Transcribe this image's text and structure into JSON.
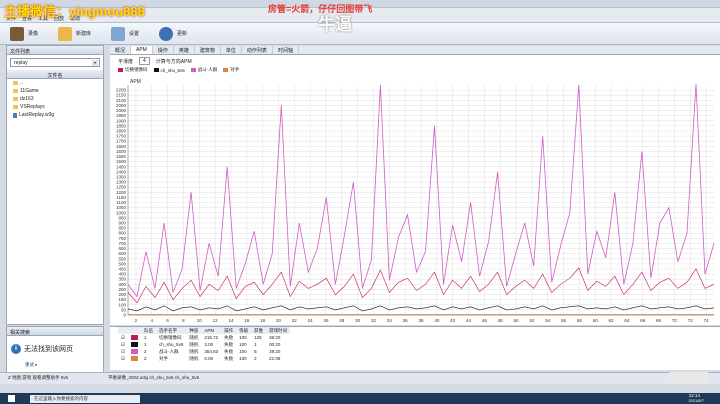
{
  "overlay": {
    "streamer": "主播微信：yingmou888",
    "room_note": "房管=火箭，仔仔回图带飞",
    "big_char": "牛逼"
  },
  "menubar": {
    "items": [
      "文件",
      "查看",
      "工具",
      "回放",
      "帮助"
    ]
  },
  "toolbar": {
    "buttons": [
      {
        "label": "录像",
        "icon": "home-icon"
      },
      {
        "label": "新建库",
        "icon": "box-icon"
      },
      {
        "label": "设置",
        "icon": "settings-icon"
      },
      {
        "label": "更新",
        "icon": "globe-icon"
      }
    ]
  },
  "left": {
    "list_title": "文件列表",
    "combo_value": "replay",
    "tree_title": "文件名",
    "files": [
      "..",
      "11Game",
      "dz163",
      "VSReplays",
      "LastReplay.w3g"
    ],
    "bottom_title": "相关搜索",
    "no_page": "无法找到该网页",
    "bottom_link": "重试 ▸"
  },
  "tabs": [
    "概况",
    "APM",
    "操作",
    "英雄",
    "建筑物",
    "单位",
    "动作列表",
    "时间轴"
  ],
  "chart_opts": {
    "label1": "平滑度",
    "label2": "计算与方向APM",
    "value": "4",
    "apm_label": "APM"
  },
  "legend": [
    "切换镜像码",
    "ch_shu_5v5",
    "战斗·人群",
    "对手"
  ],
  "colors": {
    "series1": "#c2185b",
    "series2": "#111111",
    "series3": "#d25cc7",
    "series4": "#e0843c",
    "grid": "#e0e0e0",
    "accent": "#e53935",
    "overlay_yellow": "#f5e400",
    "overlay_red": "#e53935"
  },
  "chart_data": {
    "type": "line",
    "x_ticks": [
      "2",
      "4",
      "6",
      "8",
      "10",
      "12",
      "14",
      "16",
      "18",
      "20",
      "22",
      "24",
      "26",
      "28",
      "30",
      "32",
      "34",
      "36",
      "38",
      "40",
      "42",
      "44",
      "46",
      "48",
      "50",
      "52",
      "54",
      "56",
      "58",
      "60",
      "62",
      "64",
      "66",
      "68",
      "70",
      "72",
      "74"
    ],
    "y_ticks": [
      2200,
      2150,
      2100,
      2050,
      2000,
      1950,
      1900,
      1850,
      1800,
      1750,
      1700,
      1650,
      1600,
      1550,
      1500,
      1450,
      1400,
      1350,
      1300,
      1250,
      1200,
      1150,
      1100,
      1050,
      1000,
      950,
      900,
      850,
      800,
      750,
      700,
      650,
      600,
      550,
      500,
      450,
      400,
      350,
      300,
      250,
      200,
      150,
      100,
      50,
      0
    ],
    "ylim": [
      0,
      2250
    ],
    "series": [
      {
        "name": "战斗·人群",
        "values": [
          300,
          180,
          620,
          260,
          900,
          220,
          450,
          1200,
          240,
          700,
          380,
          1450,
          260,
          500,
          820,
          300,
          600,
          2050,
          280,
          900,
          420,
          650,
          1150,
          300,
          780,
          1300,
          260,
          540,
          2250,
          340,
          760,
          980,
          420,
          620,
          1850,
          300,
          880,
          520,
          1100,
          380,
          720,
          1400,
          280,
          600,
          900,
          480,
          1750,
          320,
          680,
          1000,
          2250,
          400,
          820,
          560,
          1200,
          300,
          700,
          1600,
          360,
          900,
          1050,
          520,
          800,
          2260,
          400,
          700
        ]
      },
      {
        "name": "切换镜像码",
        "values": [
          220,
          120,
          280,
          170,
          320,
          150,
          260,
          340,
          180,
          300,
          240,
          380,
          160,
          280,
          320,
          200,
          300,
          420,
          180,
          330,
          260,
          300,
          360,
          200,
          280,
          400,
          170,
          260,
          440,
          220,
          320,
          360,
          240,
          300,
          420,
          200,
          340,
          260,
          380,
          230,
          300,
          420,
          200,
          280,
          340,
          260,
          400,
          220,
          300,
          360,
          460,
          240,
          330,
          280,
          380,
          200,
          300,
          420,
          240,
          320,
          360,
          260,
          320,
          450,
          260,
          300
        ]
      },
      {
        "name": "ch_shu_5v5",
        "values": [
          60,
          40,
          80,
          50,
          90,
          40,
          70,
          80,
          50,
          70,
          60,
          90,
          40,
          60,
          80,
          50,
          70,
          90,
          50,
          80,
          60,
          70,
          80,
          50,
          70,
          90,
          40,
          60,
          90,
          50,
          70,
          80,
          60,
          70,
          90,
          50,
          80,
          60,
          80,
          50,
          70,
          90,
          50,
          60,
          80,
          60,
          90,
          50,
          70,
          80,
          90,
          60,
          70,
          60,
          80,
          50,
          70,
          90,
          60,
          70,
          80,
          60,
          70,
          90,
          60,
          70
        ]
      }
    ]
  },
  "table": {
    "headers": [
      "队伍",
      "选手名字",
      "种族",
      "APM",
      "操作",
      "等级",
      "获胜",
      "游戏时间"
    ],
    "rows": [
      [
        "1",
        "切换镜像码",
        "随机",
        "215.72",
        "失败",
        "100",
        "125",
        "39:20"
      ],
      [
        "1",
        "ch_shu_5v5",
        "随机",
        "3.00",
        "失败",
        "100",
        "1",
        "00:20"
      ],
      [
        "2",
        "战斗·人群",
        "随机",
        "354.83",
        "失败",
        "100",
        "5",
        "39:20"
      ],
      [
        "2",
        "对手",
        "随机",
        "0.00",
        "失败",
        "100",
        "2",
        "21:08"
      ]
    ]
  },
  "status": {
    "left": "Z 地图  游戏  观看调整助手 5v5",
    "file": "平衡录像_2002.w3g  ch_shu_5v5  ch_shu_5v5"
  },
  "taskbar": {
    "search": "在这里输入你要搜索的内容",
    "time": "22:14",
    "date": "2021/8/7"
  }
}
